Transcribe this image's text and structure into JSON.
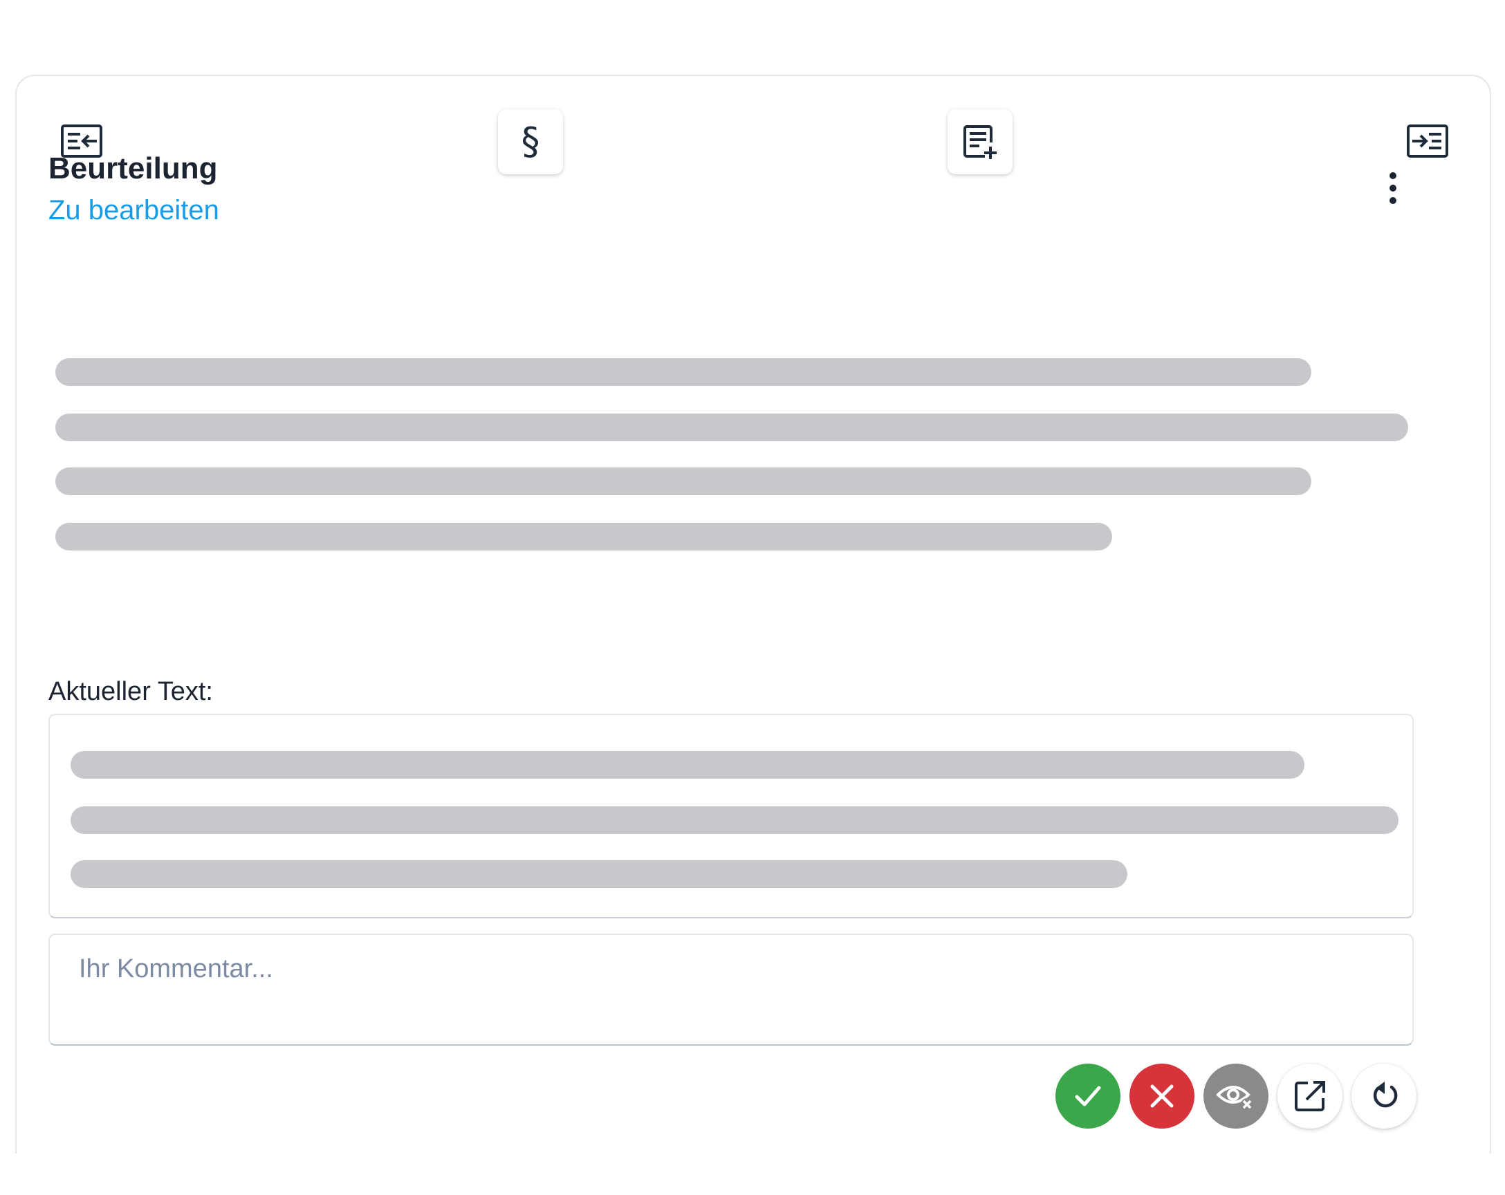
{
  "colors": {
    "accent_link": "#1a9be6",
    "accept": "#3aa84a",
    "reject": "#d6333b",
    "hide": "#8a8a8a",
    "skeleton": "#c9c6cc"
  },
  "toolbar": {
    "icons": [
      "list-arrow-left-icon",
      "paragraph-icon",
      "note-add-icon",
      "list-arrow-right-icon"
    ],
    "section_symbol": "§"
  },
  "header": {
    "title": "Beurteilung",
    "status": "Zu bearbeiten",
    "menu_icon": "more-vertical-icon"
  },
  "current_text": {
    "label": "Aktueller Text:"
  },
  "comment": {
    "placeholder": "Ihr Kommentar...",
    "value": ""
  },
  "actions": {
    "icons": [
      "check-icon",
      "close-icon",
      "eye-off-icon",
      "open-external-icon",
      "undo-icon"
    ]
  }
}
